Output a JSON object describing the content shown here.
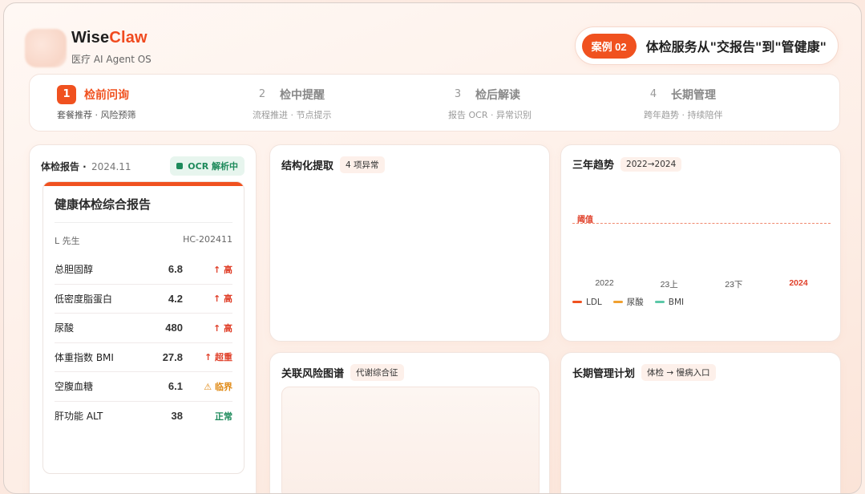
{
  "brand": {
    "name_part1": "Wise",
    "name_part2": "Claw",
    "subtitle": "医疗 AI Agent OS"
  },
  "case": {
    "badge": "案例 02",
    "title": "体检服务从\"交报告\"到\"管健康\""
  },
  "steps": [
    {
      "num": "1",
      "title": "检前问询",
      "sub": "套餐推荐 · 风险预筛",
      "active": true
    },
    {
      "num": "2",
      "title": "检中提醒",
      "sub": "流程推进 · 节点提示",
      "active": false
    },
    {
      "num": "3",
      "title": "检后解读",
      "sub": "报告 OCR · 异常识别",
      "active": false
    },
    {
      "num": "4",
      "title": "长期管理",
      "sub": "跨年趋势 · 持续陪伴",
      "active": false
    }
  ],
  "report": {
    "header": "体检报告 ·",
    "date": "2024.11",
    "ocr_badge": "OCR 解析中",
    "paper_title": "健康体检综合报告",
    "patient": "L 先生",
    "report_id": "HC-202411",
    "rows": [
      {
        "name": "总胆固醇",
        "value": "6.8",
        "flag": "↑ 高",
        "status": "high"
      },
      {
        "name": "低密度脂蛋白",
        "value": "4.2",
        "flag": "↑ 高",
        "status": "high"
      },
      {
        "name": "尿酸",
        "value": "480",
        "flag": "↑ 高",
        "status": "high"
      },
      {
        "name": "体重指数 BMI",
        "value": "27.8",
        "flag": "↑ 超重",
        "status": "high"
      },
      {
        "name": "空腹血糖",
        "value": "6.1",
        "flag": "⚠ 临界",
        "status": "warn"
      },
      {
        "name": "肝功能 ALT",
        "value": "38",
        "flag": "正常",
        "status": "ok"
      }
    ]
  },
  "extract": {
    "title": "结构化提取",
    "tag": "4 项异常"
  },
  "trend": {
    "title": "三年趋势",
    "tag": "2022→2024",
    "threshold_label": "阈值",
    "x_ticks": [
      "2022",
      "23上",
      "23下",
      "2024"
    ],
    "current_tick_index": 3,
    "legend": [
      {
        "name": "LDL",
        "color": "#f0511f"
      },
      {
        "name": "尿酸",
        "color": "#f0a030"
      },
      {
        "name": "BMI",
        "color": "#5cc8a8"
      }
    ]
  },
  "risk": {
    "title": "关联风险图谱",
    "tag": "代谢综合征"
  },
  "plan": {
    "title": "长期管理计划",
    "tag": "体检 → 慢病入口"
  }
}
